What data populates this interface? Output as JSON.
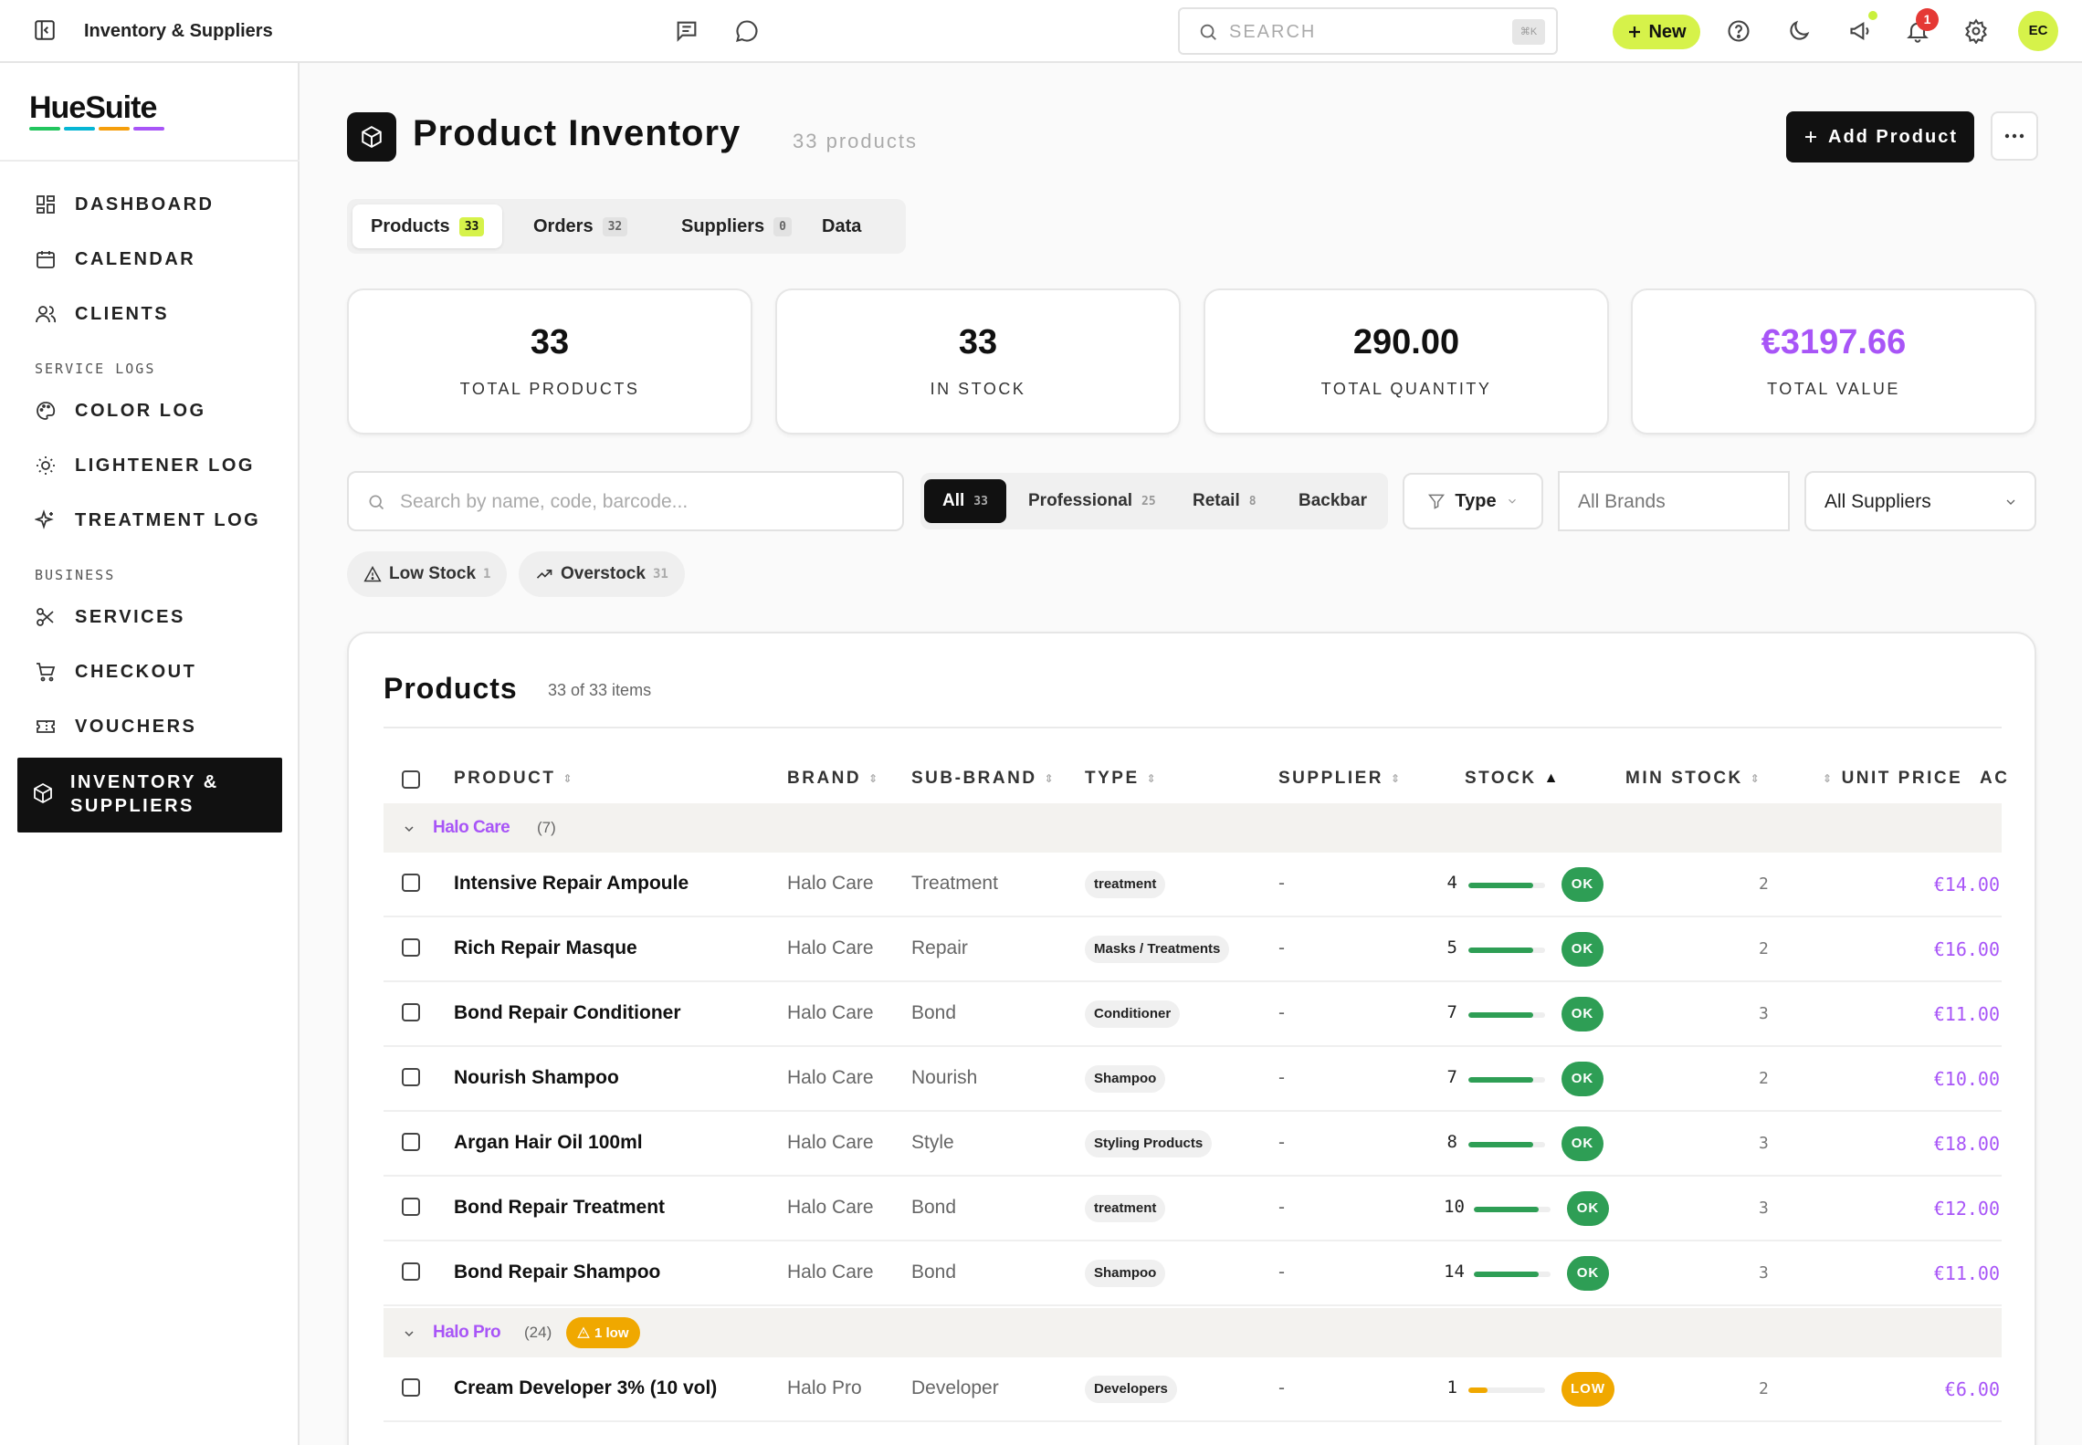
{
  "topbar": {
    "breadcrumb": "Inventory & Suppliers",
    "search_placeholder": "SEARCH",
    "search_shortcut": "⌘K",
    "new_label": "New",
    "notification_count": "1",
    "avatar_initials": "EC"
  },
  "sidebar": {
    "logo": "HueSuite",
    "logo_colors": [
      "#22c55e",
      "#06b6d4",
      "#f59e0b",
      "#a855f7"
    ],
    "items": [
      {
        "label": "DASHBOARD",
        "icon": "dashboard-icon"
      },
      {
        "label": "CALENDAR",
        "icon": "calendar-icon"
      },
      {
        "label": "CLIENTS",
        "icon": "users-icon"
      }
    ],
    "section_service_logs": "SERVICE LOGS",
    "service_items": [
      {
        "label": "COLOR LOG",
        "icon": "palette-icon"
      },
      {
        "label": "LIGHTENER LOG",
        "icon": "sun-icon"
      },
      {
        "label": "TREATMENT LOG",
        "icon": "sparkles-icon"
      }
    ],
    "section_business": "BUSINESS",
    "business_items": [
      {
        "label": "SERVICES",
        "icon": "scissors-icon"
      },
      {
        "label": "CHECKOUT",
        "icon": "cart-icon"
      },
      {
        "label": "VOUCHERS",
        "icon": "ticket-icon"
      }
    ],
    "active_item": "INVENTORY & SUPPLIERS"
  },
  "page": {
    "title": "Product Inventory",
    "count_label": "33 products",
    "add_label": "Add Product"
  },
  "tabs": [
    {
      "label": "Products",
      "count": "33"
    },
    {
      "label": "Orders",
      "count": "32"
    },
    {
      "label": "Suppliers",
      "count": "0"
    },
    {
      "label": "Data",
      "count": ""
    }
  ],
  "stats": [
    {
      "value": "33",
      "label": "TOTAL PRODUCTS"
    },
    {
      "value": "33",
      "label": "IN STOCK"
    },
    {
      "value": "290.00",
      "label": "TOTAL QUANTITY"
    },
    {
      "value": "€3197.66",
      "label": "TOTAL VALUE"
    }
  ],
  "filters": {
    "search_placeholder": "Search by name, code, barcode...",
    "segments": [
      {
        "label": "All",
        "count": "33"
      },
      {
        "label": "Professional",
        "count": "25"
      },
      {
        "label": "Retail",
        "count": "8"
      },
      {
        "label": "Backbar",
        "count": ""
      }
    ],
    "type_label": "Type",
    "brands_placeholder": "All Brands",
    "suppliers_value": "All Suppliers",
    "chips": [
      {
        "label": "Low Stock",
        "count": "1"
      },
      {
        "label": "Overstock",
        "count": "31"
      }
    ]
  },
  "table": {
    "title": "Products",
    "subtitle": "33 of 33 items",
    "columns": [
      "PRODUCT",
      "BRAND",
      "SUB-BRAND",
      "TYPE",
      "SUPPLIER",
      "STOCK",
      "MIN STOCK",
      "UNIT PRICE",
      "AC"
    ],
    "groups": [
      {
        "name": "Halo Care",
        "count": "(7)",
        "low_badge": ""
      },
      {
        "name": "Halo Pro",
        "count": "(24)",
        "low_badge": "1 low"
      }
    ],
    "rows": [
      {
        "name": "Intensive Repair Ampoule",
        "brand": "Halo Care",
        "sub": "Treatment",
        "type": "treatment",
        "supplier": "-",
        "stock": "4",
        "level": 0.85,
        "status": "OK",
        "min": "2",
        "price": "€14.00"
      },
      {
        "name": "Rich Repair Masque",
        "brand": "Halo Care",
        "sub": "Repair",
        "type": "Masks / Treatments",
        "supplier": "-",
        "stock": "5",
        "level": 0.85,
        "status": "OK",
        "min": "2",
        "price": "€16.00"
      },
      {
        "name": "Bond Repair Conditioner",
        "brand": "Halo Care",
        "sub": "Bond",
        "type": "Conditioner",
        "supplier": "-",
        "stock": "7",
        "level": 0.85,
        "status": "OK",
        "min": "3",
        "price": "€11.00"
      },
      {
        "name": "Nourish Shampoo",
        "brand": "Halo Care",
        "sub": "Nourish",
        "type": "Shampoo",
        "supplier": "-",
        "stock": "7",
        "level": 0.85,
        "status": "OK",
        "min": "2",
        "price": "€10.00"
      },
      {
        "name": "Argan Hair Oil 100ml",
        "brand": "Halo Care",
        "sub": "Style",
        "type": "Styling Products",
        "supplier": "-",
        "stock": "8",
        "level": 0.85,
        "status": "OK",
        "min": "3",
        "price": "€18.00"
      },
      {
        "name": "Bond Repair Treatment",
        "brand": "Halo Care",
        "sub": "Bond",
        "type": "treatment",
        "supplier": "-",
        "stock": "10",
        "level": 0.85,
        "status": "OK",
        "min": "3",
        "price": "€12.00"
      },
      {
        "name": "Bond Repair Shampoo",
        "brand": "Halo Care",
        "sub": "Bond",
        "type": "Shampoo",
        "supplier": "-",
        "stock": "14",
        "level": 0.85,
        "status": "OK",
        "min": "3",
        "price": "€11.00"
      },
      {
        "name": "Cream Developer 3% (10 vol)",
        "brand": "Halo Pro",
        "sub": "Developer",
        "type": "Developers",
        "supplier": "-",
        "stock": "1",
        "level": 0.25,
        "status": "LOW",
        "min": "2",
        "price": "€6.00"
      }
    ]
  },
  "colors": {
    "accent_lime": "#d6f24a",
    "brand_purple": "#a855f7",
    "ok_green": "#2e9e55",
    "low_amber": "#f0a800"
  }
}
